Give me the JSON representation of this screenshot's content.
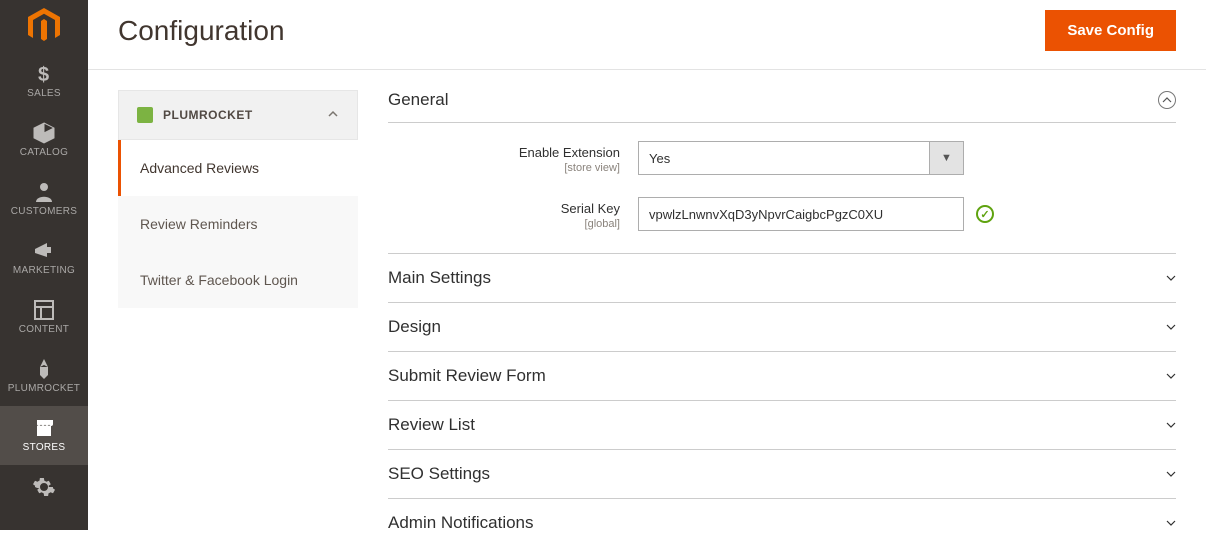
{
  "header": {
    "title": "Configuration",
    "save_label": "Save Config"
  },
  "left_nav": {
    "items": [
      {
        "label": "SALES"
      },
      {
        "label": "CATALOG"
      },
      {
        "label": "CUSTOMERS"
      },
      {
        "label": "MARKETING"
      },
      {
        "label": "CONTENT"
      },
      {
        "label": "PLUMROCKET"
      },
      {
        "label": "STORES"
      }
    ]
  },
  "side": {
    "group_label": "PLUMROCKET",
    "items": [
      {
        "label": "Advanced Reviews"
      },
      {
        "label": "Review Reminders"
      },
      {
        "label": "Twitter & Facebook Login"
      }
    ]
  },
  "general": {
    "title": "General",
    "enable_label": "Enable Extension",
    "enable_scope": "[store view]",
    "enable_value": "Yes",
    "serial_label": "Serial Key",
    "serial_scope": "[global]",
    "serial_value": "vpwlzLnwnvXqD3yNpvrCaigbcPgzC0XU"
  },
  "sections": [
    {
      "title": "Main Settings"
    },
    {
      "title": "Design"
    },
    {
      "title": "Submit Review Form"
    },
    {
      "title": "Review List"
    },
    {
      "title": "SEO Settings"
    },
    {
      "title": "Admin Notifications"
    }
  ]
}
